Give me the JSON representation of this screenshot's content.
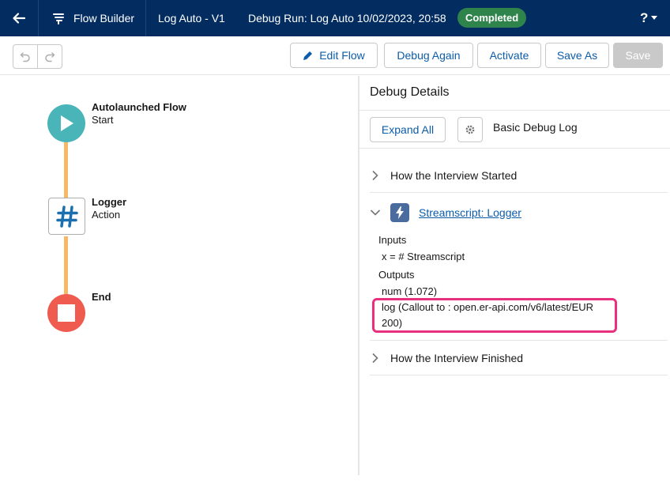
{
  "topbar": {
    "app_title": "Flow Builder",
    "flow_name": "Log Auto - V1",
    "debug_run": "Debug Run: Log Auto 10/02/2023, 20:58",
    "status_badge": "Completed",
    "help_label": "?",
    "colors": {
      "bar": "#032d60",
      "badge": "#2e844a"
    }
  },
  "toolbar": {
    "edit_flow": "Edit Flow",
    "debug_again": "Debug Again",
    "activate": "Activate",
    "save_as": "Save As",
    "save": "Save"
  },
  "canvas": {
    "start": {
      "title": "Autolaunched Flow",
      "subtitle": "Start"
    },
    "action": {
      "title": "Logger",
      "subtitle": "Action"
    },
    "end": {
      "title": "End"
    },
    "colors": {
      "start": "#4ab5b8",
      "end": "#ef5b4f",
      "connector": "#f7b866",
      "action_icon": "#1b6fae"
    }
  },
  "panel": {
    "title": "Debug Details",
    "expand_all": "Expand All",
    "debug_log_label": "Basic Debug Log",
    "sections": {
      "started": "How the Interview Started",
      "action": "Streamscript: Logger",
      "finished": "How the Interview Finished"
    },
    "details": {
      "inputs_heading": "Inputs",
      "input_line": "x = # Streamscript",
      "outputs_heading": "Outputs",
      "output_num": "num (1.072)",
      "output_log_line1": "log (Callout to : open.er-api.com/v6/latest/EUR",
      "output_log_line2": "200)"
    },
    "highlight_color": "#e8307e"
  }
}
